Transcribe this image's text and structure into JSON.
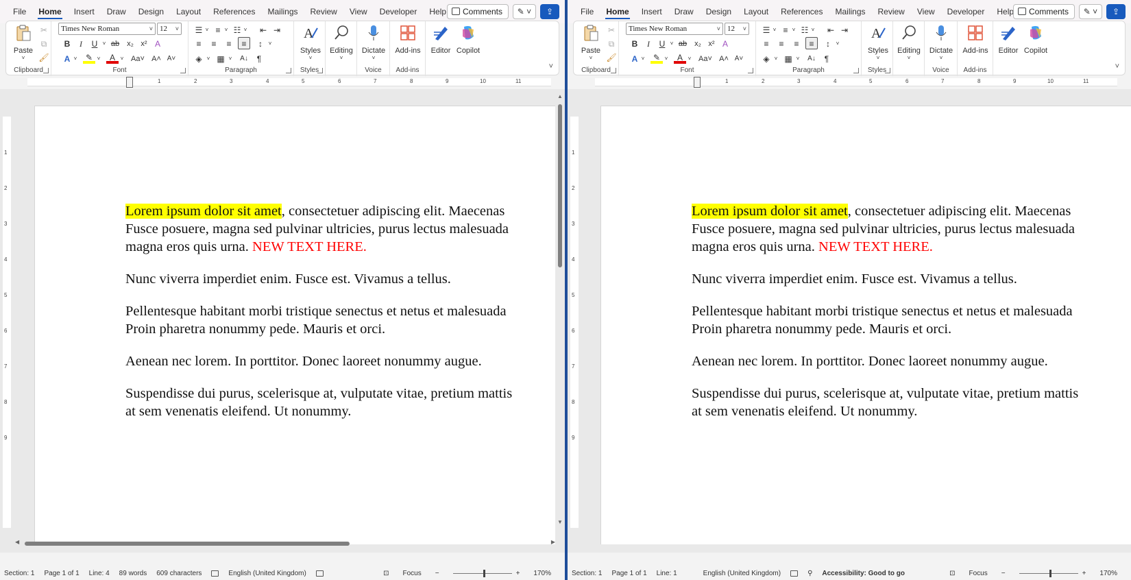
{
  "menu": [
    "File",
    "Home",
    "Insert",
    "Draw",
    "Design",
    "Layout",
    "References",
    "Mailings",
    "Review",
    "View",
    "Developer",
    "Help"
  ],
  "active_menu": "Home",
  "comments_label": "Comments",
  "ribbon": {
    "paste": "Paste",
    "clipboard": "Clipboard",
    "font_name": "Times New Roman",
    "font_size": "12",
    "font": "Font",
    "paragraph": "Paragraph",
    "styles_label": "Styles",
    "styles_group": "Styles",
    "editing": "Editing",
    "dictate": "Dictate",
    "voice": "Voice",
    "addins_btn": "Add-ins",
    "addins_group": "Add-ins",
    "editor": "Editor",
    "copilot": "Copilot"
  },
  "ruler_numbers": [
    "1",
    "2",
    "3",
    "4",
    "5",
    "6",
    "7",
    "8",
    "9",
    "10",
    "11"
  ],
  "vruler_numbers": [
    "1",
    "2",
    "3",
    "4",
    "5",
    "6",
    "7",
    "8",
    "9"
  ],
  "document": {
    "p1_highlight": "Lorem ipsum dolor sit amet",
    "p1_line1_rest": ", consectetuer adipiscing elit. Maecenas",
    "p1_line2": "Fusce posuere, magna sed pulvinar ultricies, purus lectus malesuada",
    "p1_line3_start": "magna eros quis urna. ",
    "p1_red": "NEW TEXT HERE.",
    "p2": "Nunc viverra imperdiet enim. Fusce est. Vivamus a tellus.",
    "p3_line1": "Pellentesque habitant morbi tristique senectus et netus et malesuada",
    "p3_line2": "Proin pharetra nonummy pede. Mauris et orci.",
    "p4": "Aenean nec lorem. In porttitor. Donec laoreet nonummy augue.",
    "p5_line1": "Suspendisse dui purus, scelerisque at, vulputate vitae, pretium mattis",
    "p5_line2": "at sem venenatis eleifend. Ut nonummy."
  },
  "status_left": {
    "section": "Section: 1",
    "page": "Page 1 of 1",
    "line": "Line: 4",
    "words": "89 words",
    "chars": "609 characters",
    "language": "English (United Kingdom)",
    "focus": "Focus",
    "zoom": "170%"
  },
  "status_right": {
    "section": "Section: 1",
    "page": "Page 1 of 1",
    "line": "Line: 1",
    "language": "English (United Kingdom)",
    "accessibility": "Accessibility: Good to go",
    "focus": "Focus",
    "zoom": "170%"
  },
  "colors": {
    "accent": "#185abd",
    "highlight": "#ffff00",
    "red_text": "#ff0000"
  }
}
